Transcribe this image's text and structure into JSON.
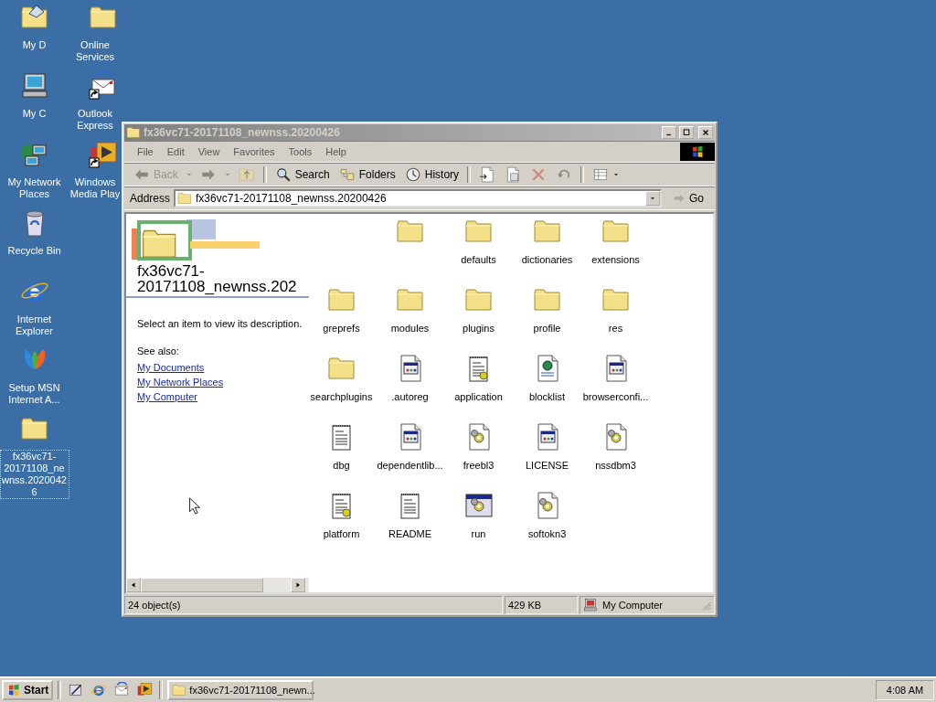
{
  "desktop_icons": [
    {
      "label": "My D",
      "kind": "documents",
      "shortcut": false,
      "selected": false
    },
    {
      "label": "My C",
      "kind": "computer",
      "shortcut": false,
      "selected": false
    },
    {
      "label": "My Network Places",
      "kind": "network",
      "shortcut": false,
      "selected": false
    },
    {
      "label": "Recycle Bin",
      "kind": "recycle",
      "shortcut": false,
      "selected": false
    },
    {
      "label": "Internet Explorer",
      "kind": "browser",
      "shortcut": false,
      "selected": false
    },
    {
      "label": "Setup MSN Internet A...",
      "kind": "butterfly",
      "shortcut": false,
      "selected": false
    },
    {
      "label": "fx36vc71-20171108_newnss.20200426",
      "kind": "folder",
      "shortcut": false,
      "selected": true
    },
    {
      "label": "Online Services",
      "kind": "folder",
      "shortcut": false,
      "selected": false
    },
    {
      "label": "Outlook Express",
      "kind": "mail",
      "shortcut": true,
      "selected": false
    },
    {
      "label": "Windows Media Play",
      "kind": "player",
      "shortcut": true,
      "selected": false
    }
  ],
  "window": {
    "title": "fx36vc71-20171108_newnss.20200426",
    "active": false,
    "menu": [
      "File",
      "Edit",
      "View",
      "Favorites",
      "Tools",
      "Help"
    ],
    "toolbar": [
      {
        "kind": "back",
        "label": "Back",
        "disabled": true
      },
      {
        "kind": "forward",
        "disabled": true
      },
      {
        "kind": "up",
        "disabled": true
      },
      {
        "kind": "search",
        "label": "Search",
        "disabled": false
      },
      {
        "kind": "folders",
        "label": "Folders",
        "disabled": false
      },
      {
        "kind": "history",
        "label": "History",
        "disabled": false
      },
      {
        "kind": "move-to",
        "disabled": false
      },
      {
        "kind": "copy-to",
        "disabled": false
      },
      {
        "kind": "delete",
        "disabled": true
      },
      {
        "kind": "undo",
        "disabled": true
      },
      {
        "kind": "views",
        "disabled": false
      }
    ],
    "address": {
      "label": "Address",
      "value": "fx36vc71-20171108_newnss.20200426",
      "go": "Go"
    },
    "side_pane": {
      "title": "fx36vc71-20171108_newnss.202",
      "description": "Select an item to view its description.",
      "see_also": "See also:",
      "links": [
        "My Documents",
        "My Network Places",
        "My Computer"
      ]
    },
    "files": [
      {
        "kind": "folder"
      },
      {
        "name": "defaults",
        "kind": "folder"
      },
      {
        "name": "dictionaries",
        "kind": "folder"
      },
      {
        "name": "extensions",
        "kind": "folder"
      },
      {
        "name": "greprefs",
        "kind": "folder"
      },
      {
        "name": "modules",
        "kind": "folder"
      },
      {
        "name": "plugins",
        "kind": "folder"
      },
      {
        "name": "profile",
        "kind": "folder"
      },
      {
        "name": "res",
        "kind": "folder"
      },
      {
        "name": "searchplugins",
        "kind": "folder"
      },
      {
        "name": ".autoreg",
        "kind": "config"
      },
      {
        "name": "application",
        "kind": "settings"
      },
      {
        "name": "blocklist",
        "kind": "web"
      },
      {
        "name": "browserconfi...",
        "kind": "config"
      },
      {
        "name": "dbg",
        "kind": "text"
      },
      {
        "name": "dependentlib...",
        "kind": "config"
      },
      {
        "name": "freebl3",
        "kind": "library"
      },
      {
        "name": "LICENSE",
        "kind": "config"
      },
      {
        "name": "nssdbm3",
        "kind": "library"
      },
      {
        "name": "platform",
        "kind": "settings"
      },
      {
        "name": "README",
        "kind": "text"
      },
      {
        "name": "run",
        "kind": "program"
      },
      {
        "name": "softokn3",
        "kind": "library"
      }
    ],
    "status_bar": {
      "objects": "24 object(s)",
      "size": "429 KB",
      "zone": "My Computer"
    }
  },
  "taskbar": {
    "start": "Start",
    "quick_launch": [
      {
        "kind": "desktop"
      },
      {
        "kind": "browser"
      },
      {
        "kind": "mail"
      },
      {
        "kind": "player"
      }
    ],
    "tasks": [
      {
        "label": "fx36vc71-20171108_newn...",
        "selected": false
      }
    ],
    "clock": "4:08 AM"
  }
}
